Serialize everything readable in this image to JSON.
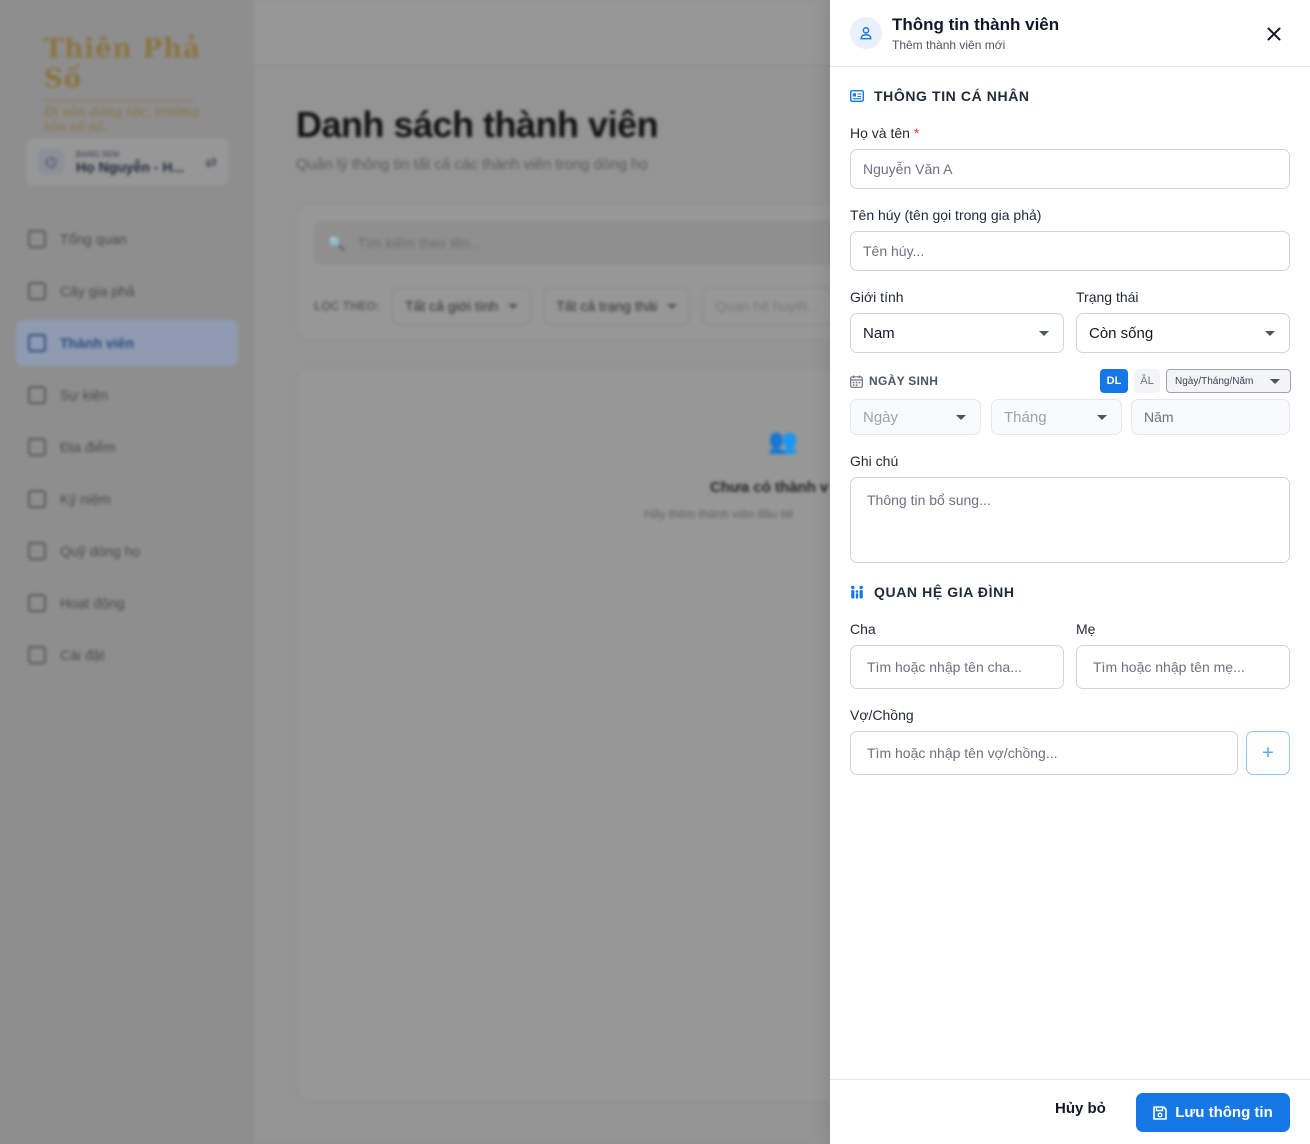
{
  "background": {
    "logo": {
      "title": "Thiên Phả Số",
      "subtitle": "Di sản dòng tộc, trường tồn số số."
    },
    "clan_card": {
      "label": "ĐANG XEM",
      "name": "Họ Nguyễn - H..."
    },
    "nav": [
      {
        "label": "Tổng quan",
        "icon": "dashboard-icon"
      },
      {
        "label": "Cây gia phả",
        "icon": "tree-icon"
      },
      {
        "label": "Thành viên",
        "icon": "members-icon",
        "active": true
      },
      {
        "label": "Sự kiện",
        "icon": "calendar-icon"
      },
      {
        "label": "Địa điểm",
        "icon": "location-icon"
      },
      {
        "label": "Kỷ niệm",
        "icon": "album-icon"
      },
      {
        "label": "Quỹ dòng họ",
        "icon": "wallet-icon"
      },
      {
        "label": "Hoạt động",
        "icon": "history-icon"
      },
      {
        "label": "Cài đặt",
        "icon": "settings-icon"
      }
    ],
    "page_title": "Danh sách thành viên",
    "page_subtitle": "Quản lý thông tin tất cả các thành viên trong dòng họ",
    "search_placeholder": "Tìm kiếm theo tên...",
    "filter_label": "LỌC THEO:",
    "filters": [
      "Tất cả giới tính",
      "Tất cả trạng thái",
      "Quan hệ huyết..."
    ],
    "empty_title": "Chưa có thành v",
    "empty_sub": "Hãy thêm thành viên đầu tiê"
  },
  "drawer": {
    "title": "Thông tin thành viên",
    "subtitle": "Thêm thành viên mới",
    "personal_section": "THÔNG TIN CÁ NHÂN",
    "full_name": {
      "label": "Họ và tên",
      "required": "*",
      "placeholder": "Nguyễn Văn A",
      "value": ""
    },
    "taboo_name": {
      "label": "Tên húy (tên gọi trong gia phả)",
      "placeholder": "Tên húy...",
      "value": ""
    },
    "gender": {
      "label": "Giới tính",
      "value": "Nam"
    },
    "status": {
      "label": "Trạng thái",
      "value": "Còn sống"
    },
    "birth": {
      "label": "NGÀY SINH",
      "calendar_solar": "DL",
      "calendar_lunar": "ÂL",
      "format": "Ngày/Tháng/Năm",
      "day": "Ngày",
      "month": "Tháng",
      "year_placeholder": "Năm"
    },
    "note": {
      "label": "Ghi chú",
      "placeholder": "Thông tin bổ sung..."
    },
    "family_section": "QUAN HỆ GIA ĐÌNH",
    "father": {
      "label": "Cha",
      "placeholder": "Tìm hoặc nhập tên cha..."
    },
    "mother": {
      "label": "Mẹ",
      "placeholder": "Tìm hoặc nhập tên mẹ..."
    },
    "spouse": {
      "label": "Vợ/Chồng",
      "placeholder": "Tìm hoặc nhập tên vợ/chồng..."
    },
    "add_spouse_symbol": "+",
    "cancel_label": "Hủy bỏ",
    "save_label": "Lưu thông tin"
  },
  "colors": {
    "primary": "#1677e6",
    "required": "#ef4444",
    "overlay": "#8f8f8f"
  }
}
